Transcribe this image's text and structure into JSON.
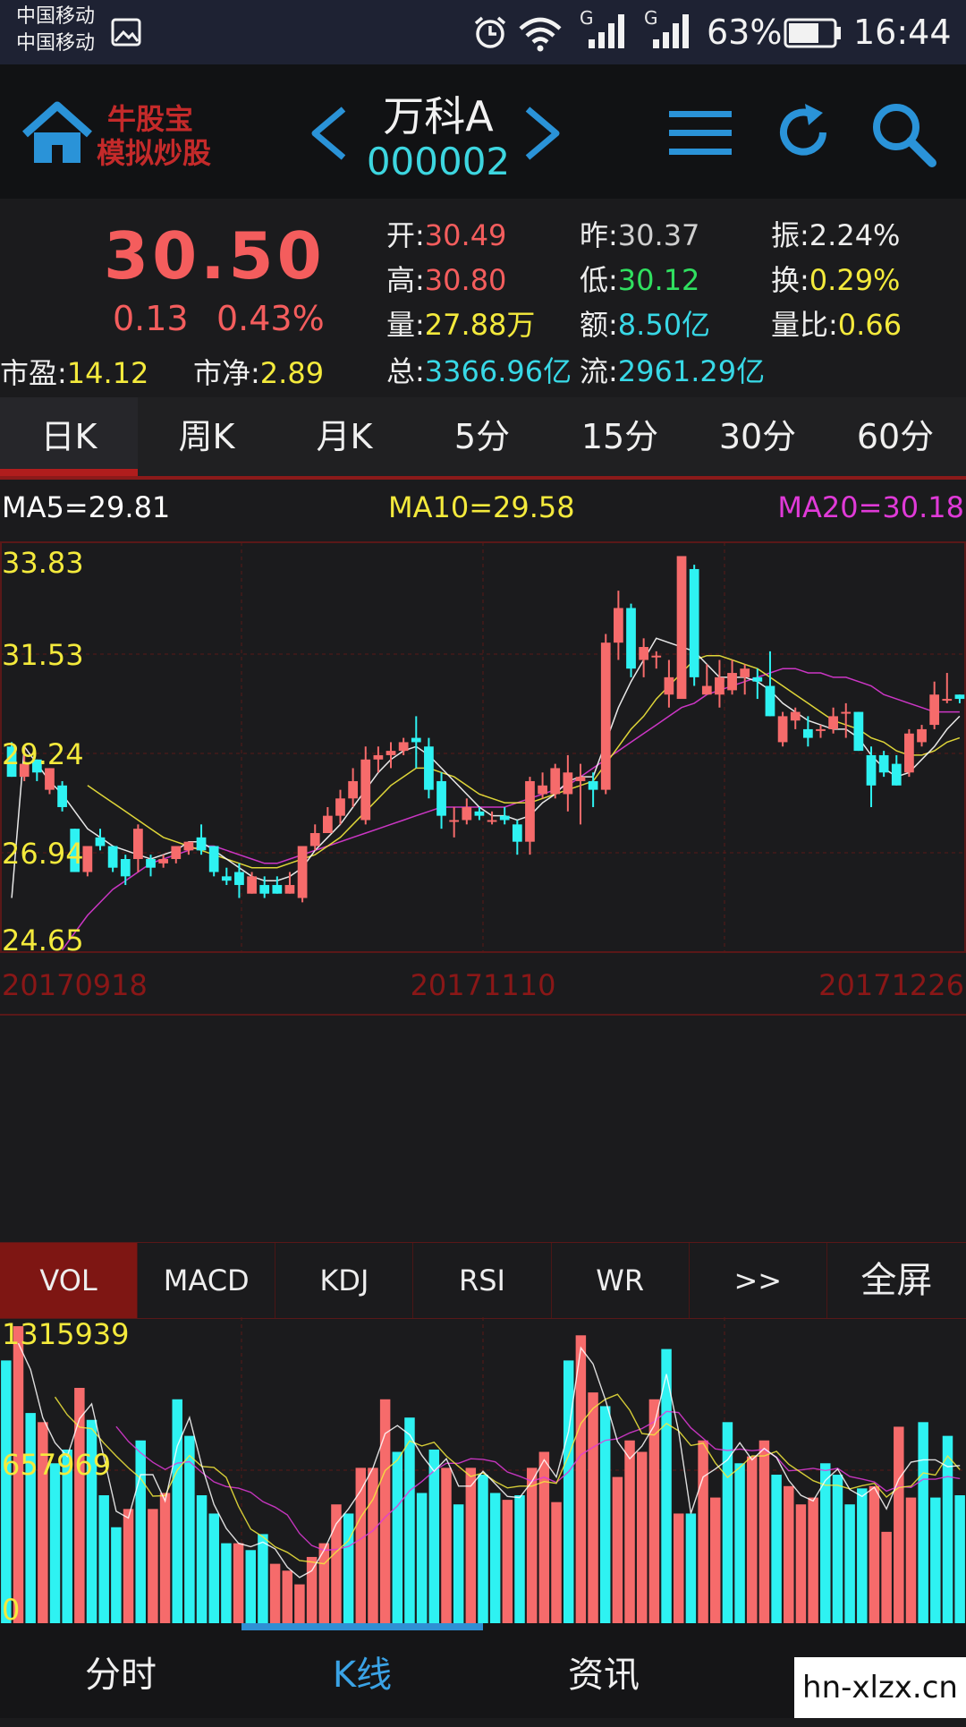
{
  "status_bar": {
    "carrier1": "中国移动",
    "carrier2": "中国移动",
    "battery": "63%",
    "time": "16:44",
    "signal_tag": "G",
    "icons": [
      "gallery-icon",
      "alarm-icon",
      "wifi-icon",
      "signal-icon",
      "battery-icon"
    ]
  },
  "header": {
    "logo_line1": "牛股宝",
    "logo_line2": "模拟炒股",
    "stock_name": "万科A",
    "stock_code": "000002",
    "icons": [
      "home-icon",
      "prev-icon",
      "next-icon",
      "menu-icon",
      "refresh-icon",
      "search-icon"
    ]
  },
  "quote": {
    "price": "30.50",
    "change": "0.13",
    "change_pct": "0.43%",
    "pe_label": "市盈:",
    "pe": "14.12",
    "pb_label": "市净:",
    "pb": "2.89",
    "open_label": "开:",
    "open": "30.49",
    "prev_label": "昨:",
    "prev": "30.37",
    "amp_label": "振:",
    "amp": "2.24%",
    "high_label": "高:",
    "high": "30.80",
    "low_label": "低:",
    "low": "30.12",
    "turn_label": "换:",
    "turn": "0.29%",
    "vol_label": "量:",
    "vol": "27.88万",
    "amt_label": "额:",
    "amt": "8.50亿",
    "vr_label": "量比:",
    "vr": "0.66",
    "total_label": "总:",
    "total": "3366.96亿",
    "float_label": "流:",
    "float": "2961.29亿"
  },
  "period_tabs": [
    "日K",
    "周K",
    "月K",
    "5分",
    "15分",
    "30分",
    "60分"
  ],
  "active_period": 0,
  "ma": {
    "ma5": "MA5=29.81",
    "ma10": "MA10=29.58",
    "ma20": "MA20=30.18",
    "colors": {
      "ma5": "#ffffff",
      "ma10": "#f4ea3c",
      "ma20": "#e03ad8"
    }
  },
  "colors": {
    "up": "#f66b6b",
    "down": "#2ef2f2",
    "grid": "#5a1818",
    "axis_text": "#f4ea3c",
    "date_text": "#8a1717"
  },
  "chart_data": {
    "type": "candlestick",
    "y_ticks": [
      "33.83",
      "31.53",
      "29.24",
      "26.94",
      "24.65"
    ],
    "ylim": [
      24.65,
      33.83
    ],
    "x_labels": [
      "20170918",
      "20171110",
      "20171226"
    ],
    "candles": [
      [
        29.4,
        28.7,
        29.5,
        28.7
      ],
      [
        28.7,
        29.0,
        29.4,
        28.6
      ],
      [
        29.1,
        28.8,
        29.1,
        28.6
      ],
      [
        28.4,
        28.9,
        28.9,
        28.3
      ],
      [
        28.5,
        28.0,
        28.6,
        27.9
      ],
      [
        27.5,
        26.5,
        27.5,
        26.5
      ],
      [
        26.5,
        27.1,
        27.1,
        26.4
      ],
      [
        27.3,
        27.1,
        27.5,
        27.0
      ],
      [
        27.1,
        26.6,
        27.1,
        26.5
      ],
      [
        26.8,
        26.4,
        26.9,
        26.2
      ],
      [
        26.8,
        27.5,
        27.6,
        26.5
      ],
      [
        26.8,
        26.6,
        26.9,
        26.4
      ],
      [
        26.7,
        26.8,
        26.9,
        26.6
      ],
      [
        26.8,
        27.1,
        27.1,
        26.7
      ],
      [
        27.0,
        27.2,
        27.2,
        26.9
      ],
      [
        27.3,
        27.0,
        27.6,
        26.9
      ],
      [
        27.1,
        26.5,
        27.1,
        26.4
      ],
      [
        26.4,
        26.3,
        26.6,
        26.2
      ],
      [
        26.5,
        26.2,
        26.7,
        25.9
      ],
      [
        26.0,
        26.4,
        26.5,
        26.0
      ],
      [
        26.2,
        26.0,
        26.4,
        25.9
      ],
      [
        26.2,
        26.0,
        26.4,
        26.0
      ],
      [
        26.0,
        26.2,
        26.5,
        26.0
      ],
      [
        25.9,
        27.1,
        27.1,
        25.8
      ],
      [
        27.1,
        27.4,
        27.6,
        27.0
      ],
      [
        27.4,
        27.8,
        28.0,
        27.4
      ],
      [
        27.8,
        28.2,
        28.4,
        27.6
      ],
      [
        28.2,
        28.6,
        28.9,
        28.0
      ],
      [
        27.7,
        29.1,
        29.4,
        27.6
      ],
      [
        29.1,
        29.2,
        29.4,
        28.8
      ],
      [
        29.2,
        29.3,
        29.5,
        28.9
      ],
      [
        29.3,
        29.5,
        29.6,
        29.2
      ],
      [
        29.6,
        29.5,
        30.1,
        28.9
      ],
      [
        29.4,
        28.4,
        29.6,
        28.2
      ],
      [
        28.6,
        27.8,
        28.8,
        27.5
      ],
      [
        27.7,
        27.7,
        28.0,
        27.3
      ],
      [
        27.7,
        28.0,
        28.2,
        27.6
      ],
      [
        27.9,
        27.8,
        28.0,
        27.7
      ],
      [
        27.7,
        27.7,
        27.9,
        27.6
      ],
      [
        27.8,
        27.7,
        28.0,
        27.6
      ],
      [
        27.6,
        27.2,
        27.7,
        26.9
      ],
      [
        27.2,
        28.6,
        28.7,
        26.9
      ],
      [
        28.3,
        28.5,
        28.8,
        28.2
      ],
      [
        28.3,
        28.9,
        29.0,
        28.2
      ],
      [
        28.3,
        28.8,
        29.2,
        27.9
      ],
      [
        28.6,
        28.7,
        29.0,
        27.6
      ],
      [
        28.6,
        28.4,
        28.8,
        28.0
      ],
      [
        28.4,
        31.8,
        32.0,
        28.3
      ],
      [
        31.8,
        32.6,
        33.0,
        31.4
      ],
      [
        32.6,
        31.2,
        32.7,
        31.0
      ],
      [
        31.4,
        31.7,
        31.9,
        31.0
      ],
      [
        31.5,
        31.5,
        31.6,
        31.2
      ],
      [
        30.6,
        31.0,
        31.4,
        30.3
      ],
      [
        30.5,
        33.8,
        33.8,
        30.5
      ],
      [
        33.5,
        31.0,
        33.6,
        30.8
      ],
      [
        30.6,
        30.8,
        31.3,
        30.6
      ],
      [
        30.6,
        31.0,
        31.4,
        30.3
      ],
      [
        30.7,
        31.1,
        31.4,
        30.6
      ],
      [
        31.0,
        31.2,
        31.3,
        30.6
      ],
      [
        31.0,
        30.9,
        31.2,
        30.5
      ],
      [
        30.8,
        30.1,
        31.6,
        30.1
      ],
      [
        29.5,
        30.1,
        30.2,
        29.4
      ],
      [
        30.0,
        30.2,
        30.3,
        29.8
      ],
      [
        29.8,
        29.6,
        30.1,
        29.4
      ],
      [
        29.8,
        29.8,
        29.9,
        29.6
      ],
      [
        29.8,
        30.1,
        30.3,
        29.7
      ],
      [
        30.2,
        30.2,
        30.4,
        29.6
      ],
      [
        30.2,
        29.3,
        30.2,
        29.3
      ],
      [
        29.2,
        28.5,
        29.4,
        28.0
      ],
      [
        29.2,
        28.8,
        29.3,
        28.7
      ],
      [
        29.0,
        28.5,
        29.2,
        28.5
      ],
      [
        28.8,
        29.7,
        29.8,
        28.7
      ],
      [
        29.5,
        29.8,
        29.9,
        29.4
      ],
      [
        29.9,
        30.6,
        30.9,
        29.8
      ],
      [
        30.5,
        30.5,
        31.1,
        30.4
      ],
      [
        30.6,
        30.5,
        30.6,
        30.4
      ]
    ],
    "ma5": [
      25.9,
      29.4,
      29.0,
      28.6,
      28.3,
      27.9,
      27.5,
      27.3,
      27.1,
      27.0,
      26.9,
      26.8,
      26.9,
      27.0,
      27.2,
      27.2,
      27.0,
      26.8,
      26.6,
      26.4,
      26.3,
      26.3,
      26.4,
      26.6,
      27.0,
      27.3,
      27.6,
      28.0,
      28.4,
      28.8,
      29.1,
      29.3,
      29.4,
      29.2,
      28.9,
      28.6,
      28.3,
      28.0,
      27.8,
      27.8,
      27.7,
      27.8,
      28.1,
      28.3,
      28.6,
      28.7,
      28.7,
      29.5,
      30.3,
      30.9,
      31.4,
      31.9,
      31.8,
      31.7,
      31.6,
      31.3,
      31.0,
      31.0,
      31.0,
      30.9,
      30.7,
      30.4,
      30.2,
      30.0,
      29.9,
      29.8,
      29.8,
      29.6,
      29.2,
      28.9,
      28.7,
      28.8,
      29.1,
      29.4,
      29.8,
      30.1
    ],
    "ma10": [
      null,
      null,
      null,
      null,
      null,
      null,
      28.5,
      28.3,
      28.1,
      27.9,
      27.7,
      27.5,
      27.3,
      27.2,
      27.1,
      27.0,
      26.9,
      26.8,
      26.7,
      26.6,
      26.6,
      26.6,
      26.7,
      26.8,
      26.9,
      27.1,
      27.3,
      27.6,
      27.9,
      28.2,
      28.5,
      28.7,
      28.9,
      28.9,
      28.8,
      28.7,
      28.5,
      28.3,
      28.2,
      28.1,
      28.1,
      28.1,
      28.2,
      28.3,
      28.4,
      28.5,
      28.6,
      29.0,
      29.4,
      29.8,
      30.1,
      30.5,
      30.8,
      31.1,
      31.4,
      31.5,
      31.5,
      31.4,
      31.3,
      31.2,
      31.0,
      30.8,
      30.6,
      30.4,
      30.2,
      30.0,
      29.9,
      29.8,
      29.6,
      29.5,
      29.3,
      29.2,
      29.2,
      29.3,
      29.5,
      29.6
    ],
    "ma20": [
      null,
      null,
      null,
      null,
      24.7,
      25.1,
      25.5,
      25.8,
      26.1,
      26.3,
      26.5,
      26.7,
      26.8,
      26.9,
      27.0,
      27.1,
      27.1,
      27.0,
      26.9,
      26.8,
      26.7,
      26.7,
      26.8,
      26.9,
      27.0,
      27.1,
      27.2,
      27.3,
      27.4,
      27.5,
      27.6,
      27.7,
      27.8,
      27.9,
      28.0,
      28.0,
      28.0,
      28.0,
      28.0,
      28.0,
      28.1,
      28.2,
      28.3,
      28.4,
      28.5,
      28.7,
      28.9,
      29.1,
      29.3,
      29.5,
      29.7,
      29.9,
      30.1,
      30.3,
      30.4,
      30.6,
      30.7,
      30.8,
      30.9,
      31.0,
      31.1,
      31.2,
      31.2,
      31.1,
      31.1,
      31.0,
      31.0,
      30.9,
      30.8,
      30.6,
      30.5,
      30.4,
      30.3,
      30.2,
      30.2,
      30.2
    ]
  },
  "volume_data": {
    "y_ticks": [
      "1315939",
      "657969",
      "0"
    ],
    "ymax": 1315939,
    "bars": [
      1150000,
      1300000,
      920000,
      880000,
      700000,
      760000,
      1030000,
      890000,
      560000,
      420000,
      500000,
      800000,
      500000,
      570000,
      980000,
      820000,
      560000,
      480000,
      350000,
      350000,
      320000,
      390000,
      260000,
      230000,
      170000,
      290000,
      350000,
      520000,
      480000,
      680000,
      680000,
      980000,
      750000,
      900000,
      570000,
      760000,
      680000,
      520000,
      680000,
      650000,
      570000,
      540000,
      560000,
      680000,
      750000,
      530000,
      1150000,
      1260000,
      1010000,
      950000,
      640000,
      800000,
      750000,
      980000,
      1200000,
      480000,
      480000,
      800000,
      550000,
      880000,
      700000,
      730000,
      800000,
      650000,
      600000,
      520000,
      550000,
      700000,
      650000,
      520000,
      590000,
      600000,
      400000,
      860000,
      550000,
      880000,
      550000,
      820000,
      560000
    ]
  },
  "indicator_tabs": [
    "VOL",
    "MACD",
    "KDJ",
    "RSI",
    "WR",
    ">>",
    "全屏"
  ],
  "active_indicator": 0,
  "bottom_nav": [
    "分时",
    "K线",
    "资讯"
  ],
  "active_nav": 1,
  "watermark": "hn-xlzx.cn"
}
